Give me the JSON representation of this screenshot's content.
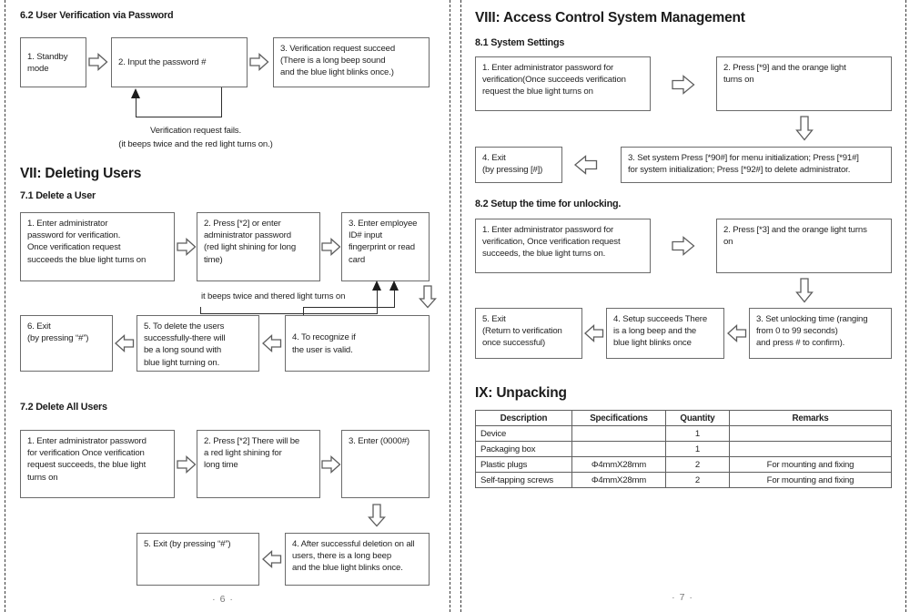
{
  "left_page": {
    "section_62_title": "6.2 User Verification via Password",
    "flow_62": {
      "box1": "1. Standby\nmode",
      "box2": "2. Input the password #",
      "box3": "3. Verification request succeed\n(There is a long beep sound\nand the blue light blinks once.)",
      "loop_label_line1": "Verification request fails.",
      "loop_label_line2": "(it beeps twice and the red light turns on.)"
    },
    "section_vii_title": "VII: Deleting Users",
    "section_71_title": "7.1 Delete a User",
    "flow_71": {
      "box1": "1. Enter administrator\npassword for verification.\nOnce verification request\nsucceeds the blue light turns on",
      "box2": "2. Press [*2] or enter\nadministrator password\n(red light shining for long\ntime)",
      "box3": "3. Enter employee\nID# input\nfingerprint or read\ncard",
      "box4": "4. To recognize if\nthe user is valid.",
      "box5": "5. To delete the users\nsuccessfully-there will\nbe a long sound with\nblue light turning on.",
      "box6": "6. Exit\n(by pressing “#”)",
      "loop_label": "it beeps twice and thered light turns on"
    },
    "section_72_title": "7.2 Delete All Users",
    "flow_72": {
      "box1": "1. Enter administrator password\nfor verification Once verification\nrequest succeeds, the blue light\nturns on",
      "box2": "2. Press [*2] There will be\na red light shining for\nlong time",
      "box3": "3. Enter (0000#)",
      "box4": "4. After successful deletion on all\nusers, there is a long beep\nand the blue light blinks once.",
      "box5": "5. Exit (by pressing “#”)"
    },
    "page_number": "· 6 ·"
  },
  "right_page": {
    "section_viii_title": "VIII: Access Control System Management",
    "section_81_title": "8.1 System Settings",
    "flow_81": {
      "box1": "1. Enter administrator password for\nverification(Once succeeds verification\nrequest the blue light turns on",
      "box2": "2. Press [*9] and the orange light\nturns on",
      "box3": "3. Set system Press [*90#] for menu initialization; Press [*91#]\nfor system initialization; Press [*92#] to delete administrator.",
      "box4": "4. Exit\n(by pressing [#])"
    },
    "section_82_title": "8.2 Setup the time for unlocking.",
    "flow_82": {
      "box1": "1. Enter administrator password for\nverification, Once verification request\nsucceeds, the blue light turns on.",
      "box2": "2. Press [*3] and the orange light turns\non",
      "box3": "3. Set unlocking time (ranging\nfrom 0 to 99 seconds)\nand press # to confirm).",
      "box4": "4. Setup succeeds There\nis a long beep and the\nblue light blinks once",
      "box5": "5. Exit\n(Return to verification\nonce successful)"
    },
    "section_ix_title": "IX: Unpacking",
    "unpacking_table": {
      "headers": [
        "Description",
        "Specifications",
        "Quantity",
        "Remarks"
      ],
      "rows": [
        [
          "Device",
          "",
          "1",
          ""
        ],
        [
          "Packaging box",
          "",
          "1",
          ""
        ],
        [
          "Plastic plugs",
          "Φ4mmX28mm",
          "2",
          "For mounting and fixing"
        ],
        [
          "Self-tapping screws",
          "Φ4mmX28mm",
          "2",
          "For mounting and fixing"
        ]
      ]
    },
    "page_number": "· 7 ·"
  }
}
